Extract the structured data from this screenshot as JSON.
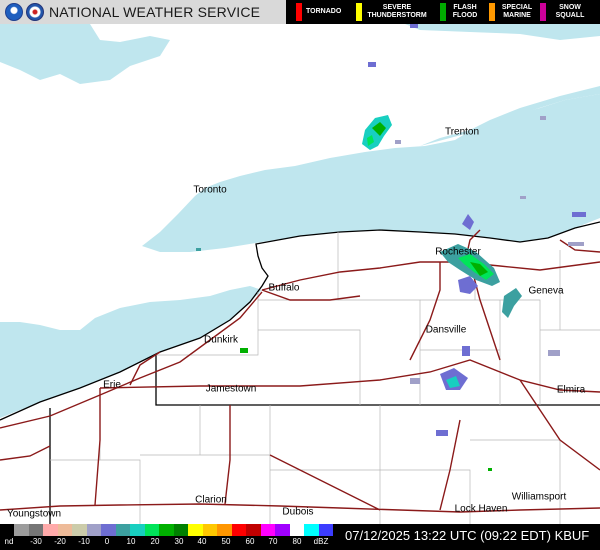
{
  "header": {
    "title": "NATIONAL WEATHER SERVICE",
    "warnings": [
      {
        "label": "TORNADO",
        "color": "#ff0000"
      },
      {
        "label": "SEVERE THUNDERSTORM",
        "color": "#ffff00"
      },
      {
        "label": "FLASH FLOOD",
        "color": "#00aa00"
      },
      {
        "label": "SPECIAL MARINE",
        "color": "#ff9900"
      },
      {
        "label": "SNOW SQUALL",
        "color": "#cc0099"
      }
    ]
  },
  "places": [
    "Trenton",
    "Toronto",
    "Rochester",
    "Geneva",
    "Buffalo",
    "Dansville",
    "Dunkirk",
    "Erie",
    "Jamestown",
    "Elmira",
    "Clarion",
    "Williamsport",
    "Youngstown",
    "Dubois",
    "Lock Haven"
  ],
  "legend": {
    "ticks": [
      "nd",
      "-30",
      "-20",
      "-10",
      "0",
      "10",
      "20",
      "30",
      "40",
      "50",
      "60",
      "70",
      "80",
      "dBZ"
    ],
    "colors": [
      "#000000",
      "#9c9c9c",
      "#767676",
      "#ffaaaa",
      "#eebb99",
      "#ccccaa",
      "#a0a0c8",
      "#6e6ed2",
      "#3ca0a0",
      "#18cfc0",
      "#00e45a",
      "#00b000",
      "#008000",
      "#ffff00",
      "#ffc800",
      "#ff9600",
      "#ff0000",
      "#c00000",
      "#ff00ff",
      "#a000ff",
      "#ffffff",
      "#00ffff",
      "#3c3cff"
    ]
  },
  "timestamp": "07/12/2025 13:22 UTC (09:22 EDT)",
  "station": "KBUF",
  "colors": {
    "lake": "#bfe6ee",
    "land": "#ffffff",
    "highway": "#8b1a1a",
    "border": "#000000",
    "county": "#b0b0b0"
  }
}
